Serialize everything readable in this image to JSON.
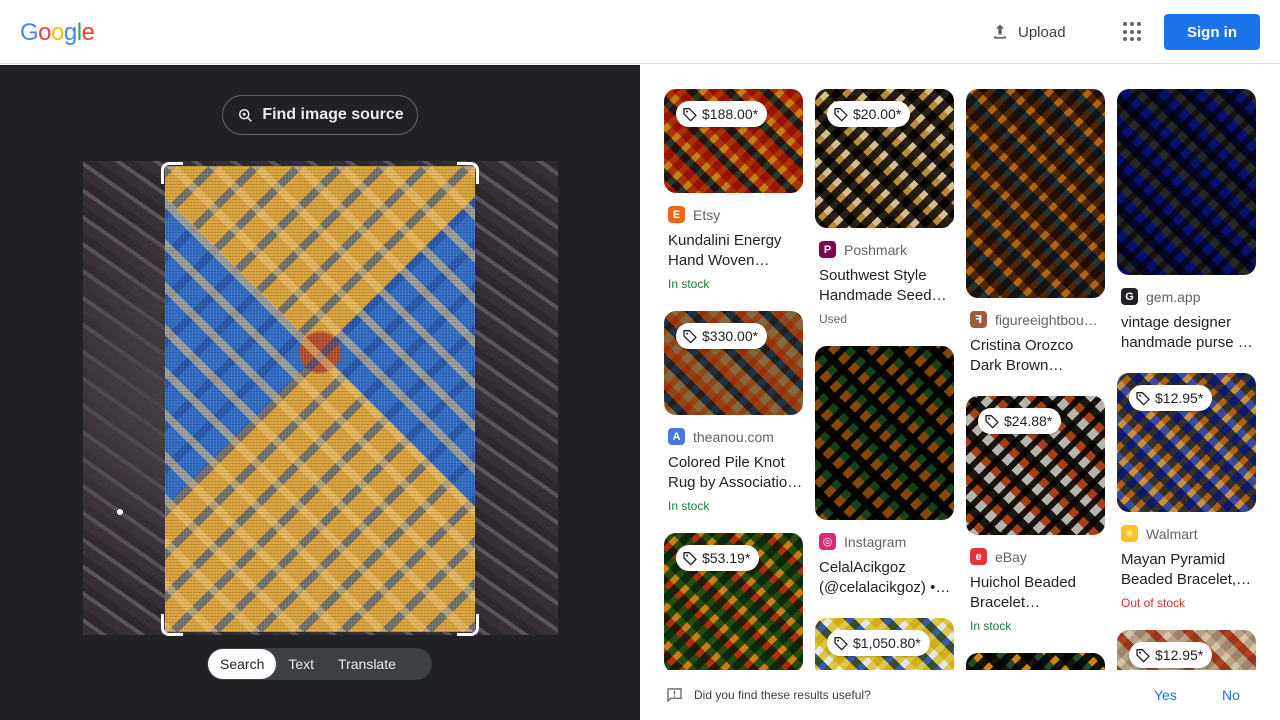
{
  "header": {
    "logo_letters": [
      {
        "ch": "G",
        "color": "#4285F4"
      },
      {
        "ch": "o",
        "color": "#EA4335"
      },
      {
        "ch": "o",
        "color": "#FBBC05"
      },
      {
        "ch": "g",
        "color": "#4285F4"
      },
      {
        "ch": "l",
        "color": "#34A853"
      },
      {
        "ch": "e",
        "color": "#EA4335"
      }
    ],
    "upload_label": "Upload",
    "signin_label": "Sign in"
  },
  "lens": {
    "find_source_label": "Find image source",
    "modes": [
      {
        "label": "Search",
        "active": true
      },
      {
        "label": "Text",
        "active": false
      },
      {
        "label": "Translate",
        "active": false
      }
    ]
  },
  "results": {
    "columns": [
      [
        {
          "price": "$188.00*",
          "source": "Etsy",
          "favicon": {
            "letter": "E",
            "color": "#F1641E"
          },
          "title": "Kundalini Energy Hand Woven…",
          "stock": "In stock",
          "stock_kind": "in",
          "thumb_height": 104,
          "thumb_colors": [
            "#c2451e",
            "#2b4fa8",
            "#e0b340"
          ]
        },
        {
          "price": "$330.00*",
          "source": "theanou.com",
          "favicon": {
            "letter": "A",
            "color": "#4a76d6"
          },
          "title": "Colored Pile Knot Rug by Associatio…",
          "stock": "In stock",
          "stock_kind": "in",
          "thumb_height": 104,
          "thumb_colors": [
            "#b8a27c",
            "#2a4d8f",
            "#c96b2a"
          ]
        },
        {
          "price": "$53.19*",
          "source": "",
          "favicon": null,
          "title": "",
          "stock": "",
          "stock_kind": "",
          "thumb_height": 140,
          "thumb_colors": [
            "#2d6a35",
            "#c4412a",
            "#e3b24a"
          ]
        }
      ],
      [
        {
          "price": "$20.00*",
          "source": "Poshmark",
          "favicon": {
            "letter": "P",
            "color": "#7f0353"
          },
          "title": "Southwest Style Handmade Seed…",
          "stock": "Used",
          "stock_kind": "used",
          "thumb_height": 139,
          "thumb_colors": [
            "#2a2520",
            "#c7a34a",
            "#e8dcc0"
          ]
        },
        {
          "price": "",
          "source": "Instagram",
          "favicon": {
            "letter": "◎",
            "color": "#d62976"
          },
          "title": "CelalAcikgoz (@celalacikgoz) •…",
          "stock": "",
          "stock_kind": "",
          "thumb_height": 174,
          "thumb_colors": [
            "#b8862d",
            "#1f7a8a",
            "#0d0d0d"
          ]
        },
        {
          "price": "$1,050.80*",
          "source": "",
          "favicon": null,
          "title": "",
          "stock": "",
          "stock_kind": "",
          "thumb_height": 60,
          "thumb_colors": [
            "#e8d24a",
            "#3a5fb0",
            "#f2f2f2"
          ]
        }
      ],
      [
        {
          "price": "",
          "source": "figureeightbou…",
          "favicon": {
            "letter": "ꟻ",
            "color": "#a15a3a"
          },
          "title": "Cristina Orozco Dark Brown…",
          "stock": "",
          "stock_kind": "",
          "thumb_height": 209,
          "thumb_colors": [
            "#5a3a22",
            "#2a52c8",
            "#d4a040"
          ]
        },
        {
          "price": "$24.88*",
          "source": "eBay",
          "favicon": {
            "letter": "e",
            "color": "#e53238"
          },
          "title": "Huichol Beaded Bracelet…",
          "stock": "In stock",
          "stock_kind": "in",
          "thumb_height": 139,
          "thumb_colors": [
            "#d8d6d2",
            "#c44a1c",
            "#1e1a16"
          ]
        },
        {
          "price": "",
          "source": "",
          "favicon": null,
          "title": "",
          "stock": "",
          "stock_kind": "",
          "thumb_height": 60,
          "thumb_colors": [
            "#1a1a1a",
            "#2a6ab8",
            "#e6b83a"
          ]
        }
      ],
      [
        {
          "price": "",
          "source": "gem.app",
          "favicon": {
            "letter": "G",
            "color": "#202124"
          },
          "title": "vintage designer handmade purse …",
          "stock": "",
          "stock_kind": "",
          "thumb_height": 186,
          "thumb_colors": [
            "#2a3fa8",
            "#d6a437",
            "#1a1a40"
          ]
        },
        {
          "price": "$12.95*",
          "source": "Walmart",
          "favicon": {
            "letter": "✳",
            "color": "#ffc220"
          },
          "title": "Mayan Pyramid Beaded Bracelet,…",
          "stock": "Out of stock",
          "stock_kind": "oos",
          "thumb_height": 139,
          "thumb_colors": [
            "#3d4fa8",
            "#f0f0f0",
            "#d49a40"
          ]
        },
        {
          "price": "$12.95*",
          "source": "",
          "favicon": null,
          "title": "",
          "stock": "",
          "stock_kind": "",
          "thumb_height": 60,
          "thumb_colors": [
            "#c9b8a4",
            "#c44a2a",
            "#e8e0d0"
          ]
        }
      ]
    ]
  },
  "feedback": {
    "question": "Did you find these results useful?",
    "yes_label": "Yes",
    "no_label": "No"
  }
}
